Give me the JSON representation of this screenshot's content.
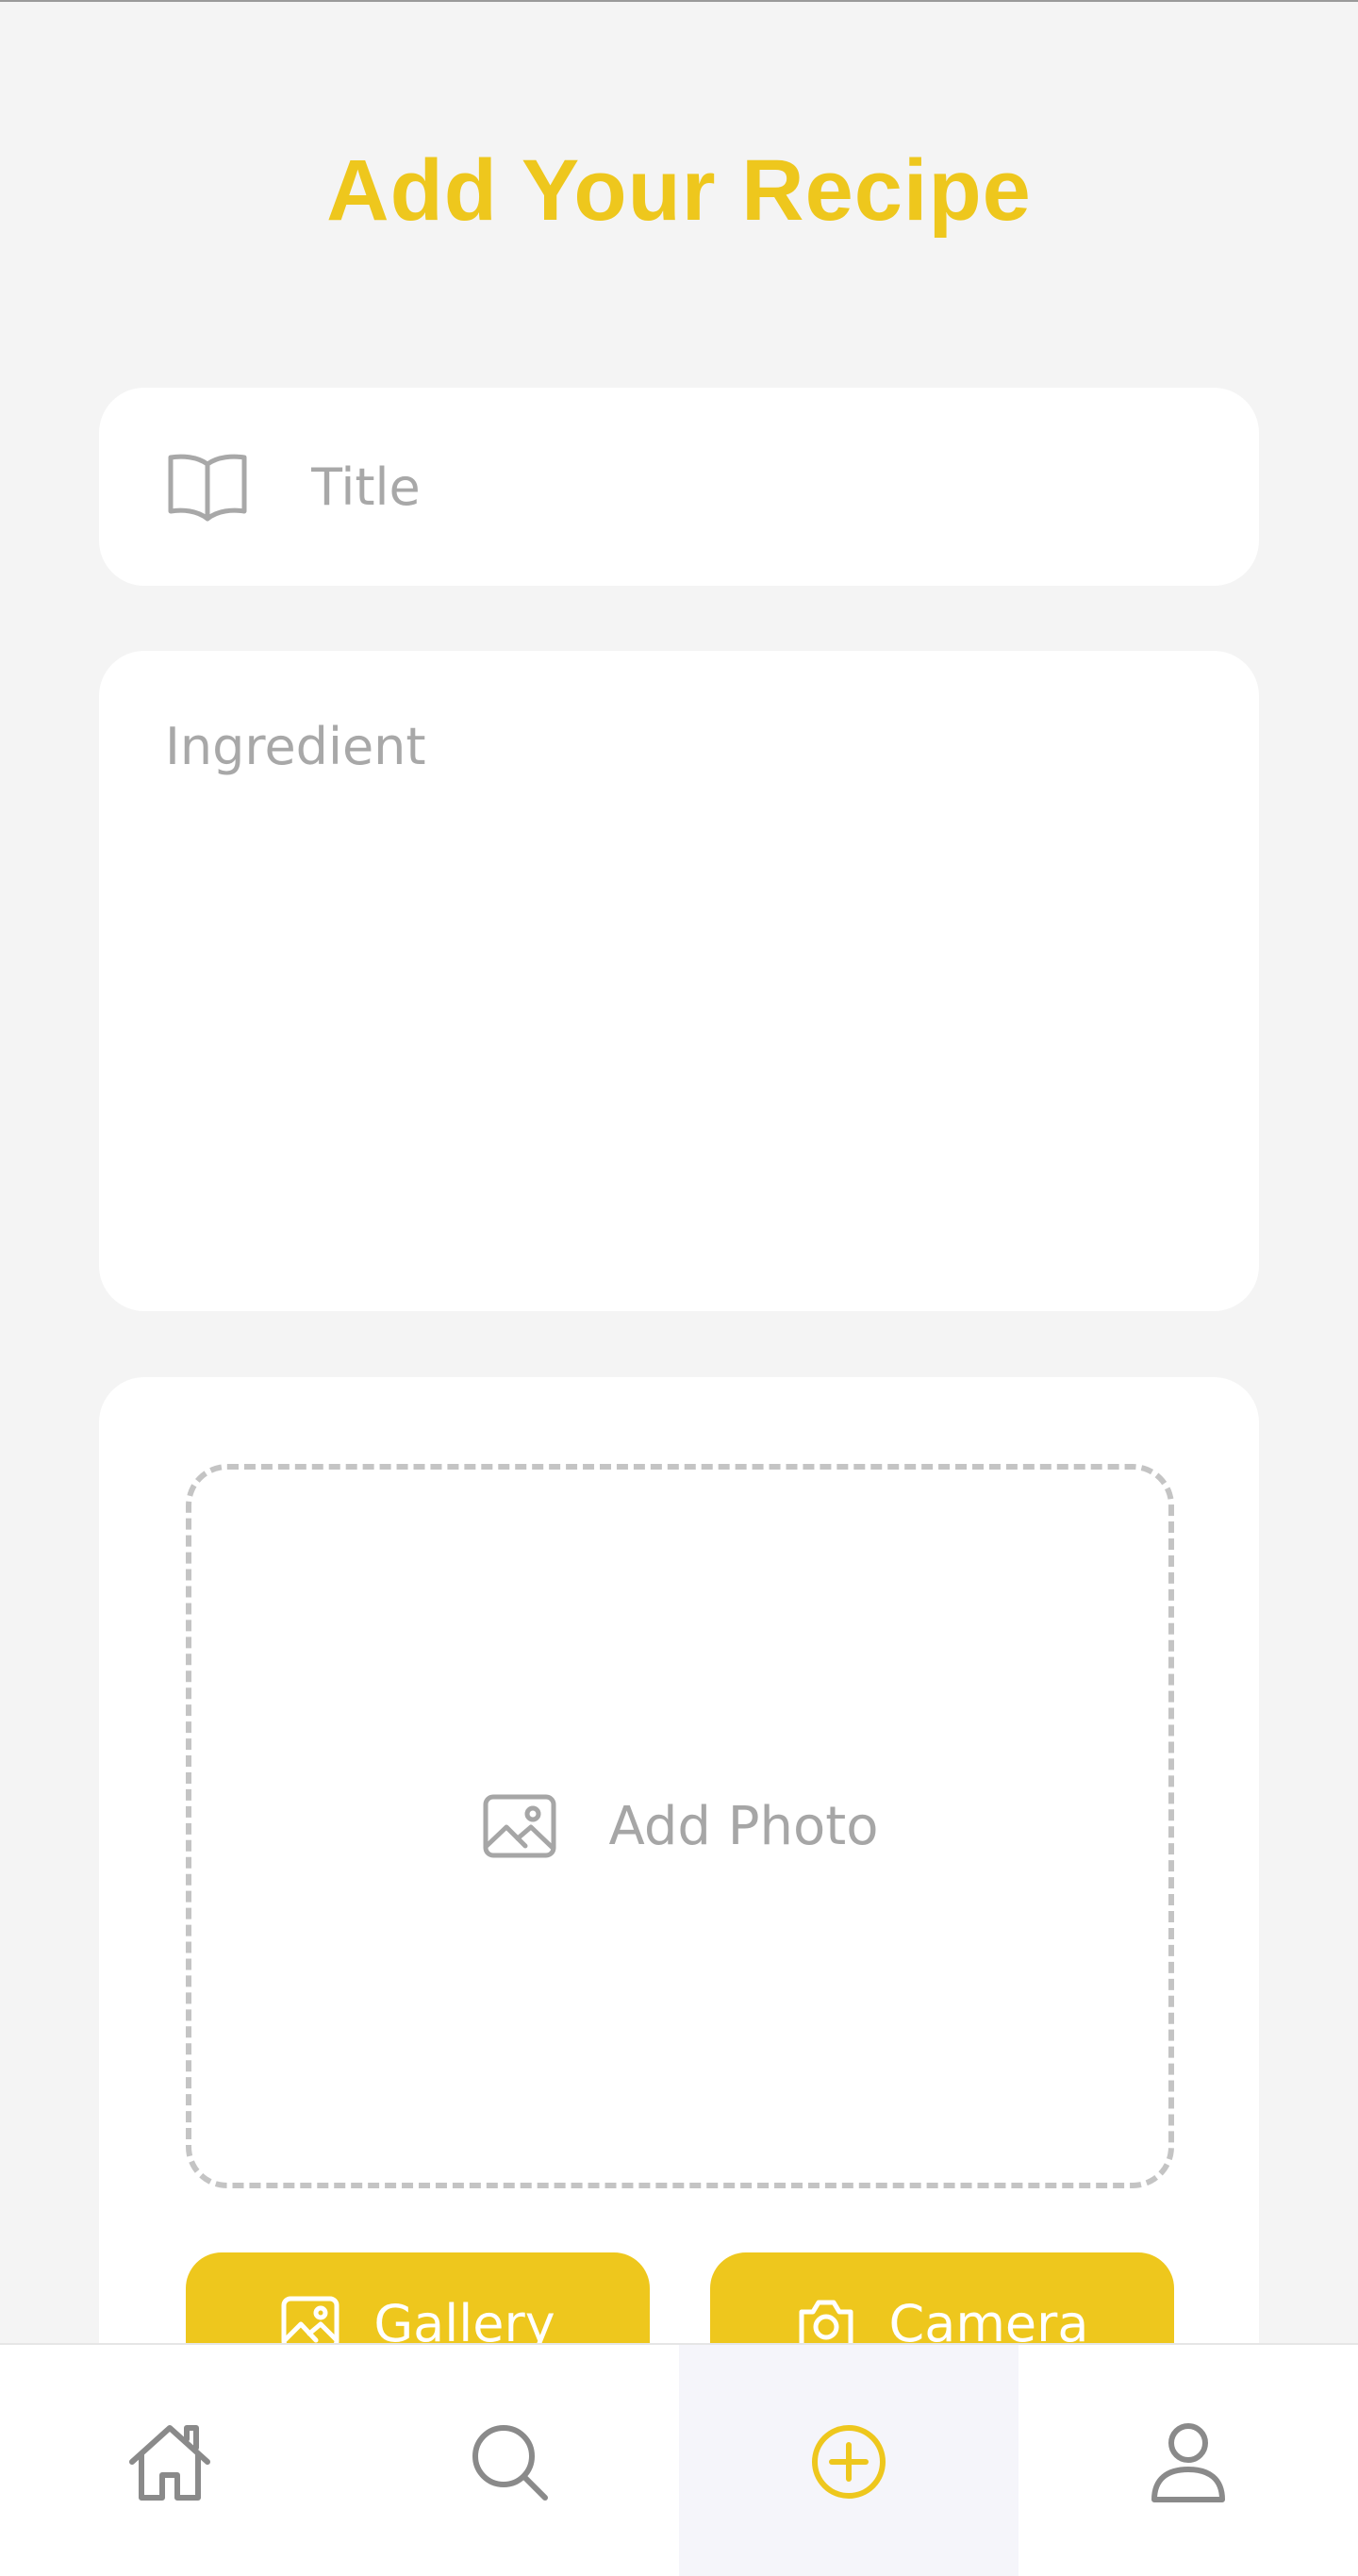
{
  "header": {
    "title": "Add Your Recipe"
  },
  "form": {
    "title_placeholder": "Title",
    "title_value": "",
    "ingredient_placeholder": "Ingredient",
    "ingredient_value": ""
  },
  "photo": {
    "dropzone_label": "Add Photo",
    "gallery_label": "Gallery",
    "camera_label": "Camera"
  },
  "nav": {
    "items": [
      {
        "name": "home",
        "icon": "home-icon",
        "active": false
      },
      {
        "name": "search",
        "icon": "search-icon",
        "active": false
      },
      {
        "name": "add",
        "icon": "plus-circle-icon",
        "active": true
      },
      {
        "name": "profile",
        "icon": "user-icon",
        "active": false
      }
    ]
  },
  "colors": {
    "accent": "#eec71d",
    "background": "#f4f4f4",
    "placeholder": "#a8a8a8",
    "icon": "#8a8a8a"
  }
}
